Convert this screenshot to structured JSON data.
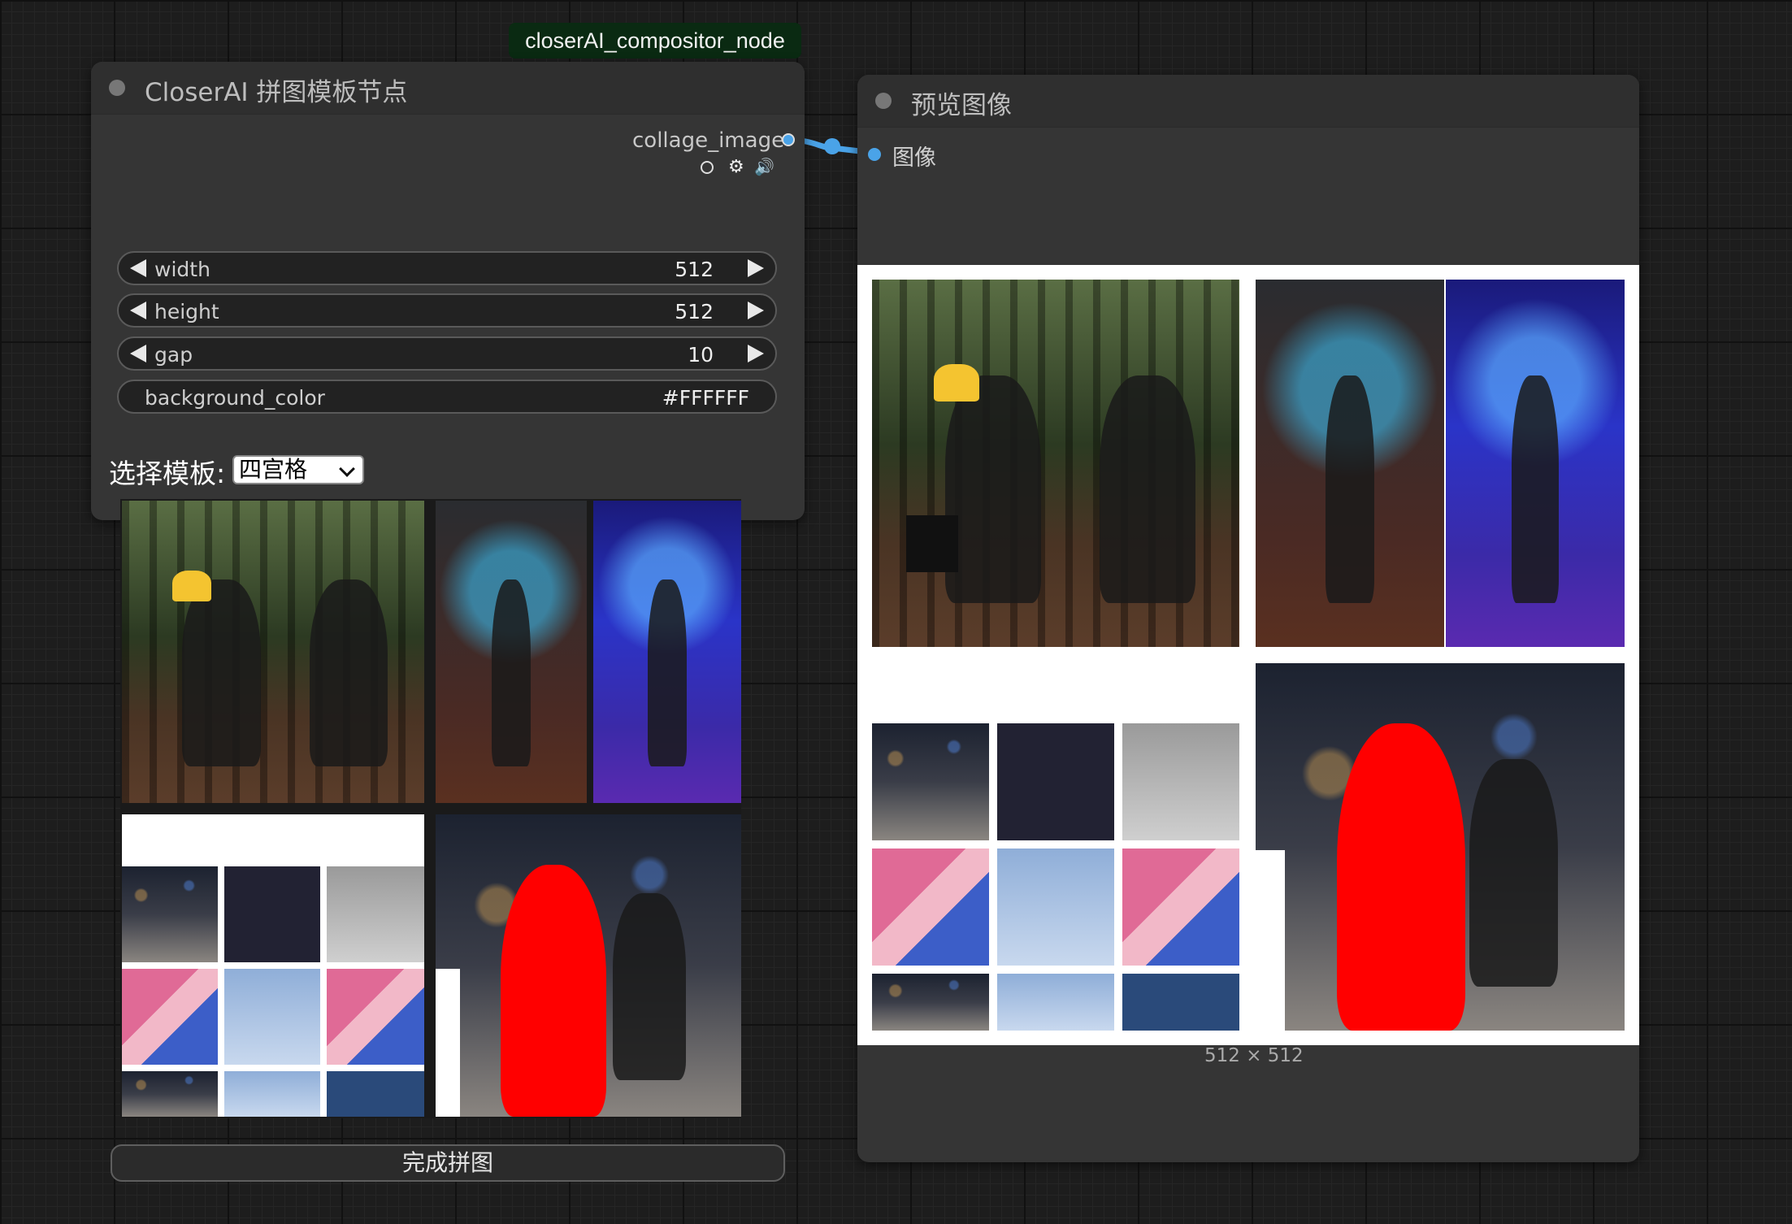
{
  "badge": "closerAI_compositor_node",
  "compositor_node": {
    "title": "CloserAI 拼图模板节点",
    "output_label": "collage_image",
    "widgets": {
      "width": {
        "label": "width",
        "value": "512"
      },
      "height": {
        "label": "height",
        "value": "512"
      },
      "gap": {
        "label": "gap",
        "value": "10"
      },
      "background_color": {
        "label": "background_color",
        "value": "#FFFFFF"
      }
    },
    "template_label": "选择模板:",
    "template_selected": "四宫格",
    "finish_button": "完成拼图"
  },
  "preview_node": {
    "title": "预览图像",
    "input_label": "图像",
    "size_text": "512 × 512"
  },
  "colors": {
    "link": "#4aa3e8",
    "node_bg": "#353535",
    "badge_bg": "#0a2a12",
    "mask_red": "#ff0000"
  }
}
